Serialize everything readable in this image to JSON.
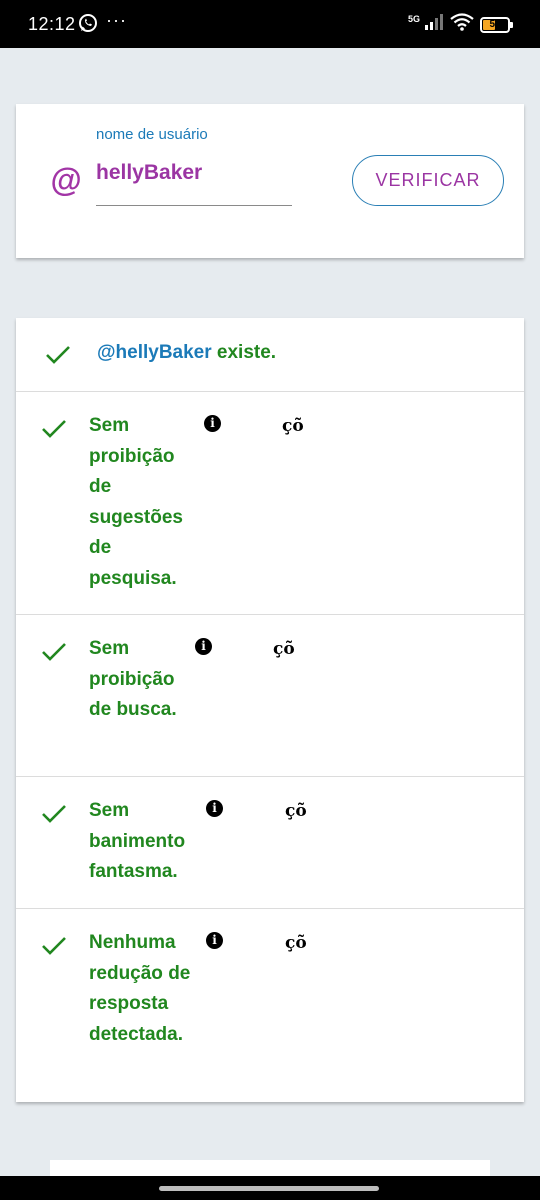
{
  "status_bar": {
    "time": "12:12",
    "dots": "···",
    "network": "5G",
    "battery": "50"
  },
  "username_card": {
    "at_symbol": "@",
    "field_label": "nome de usuário",
    "field_value": "hellyBaker",
    "verify_button": "VERIFICAR"
  },
  "results": {
    "exists": {
      "username": "@hellyBaker",
      "suffix": " existe."
    },
    "items": [
      {
        "text": "Sem proibição de sugestões de pesquisa.",
        "info_glyph": "i",
        "extra": "çõ"
      },
      {
        "text": "Sem proibição de busca.",
        "info_glyph": "i",
        "extra": "çõ"
      },
      {
        "text": "Sem banimento fantasma.",
        "info_glyph": "i",
        "extra": "çõ"
      },
      {
        "text": "Nenhuma redução de resposta detectada.",
        "info_glyph": "i",
        "extra": "çõ"
      }
    ]
  },
  "colors": {
    "accent_purple": "#9b35a3",
    "link_blue": "#1b7ab8",
    "success_green": "#21871f",
    "background": "#e6ebef"
  }
}
